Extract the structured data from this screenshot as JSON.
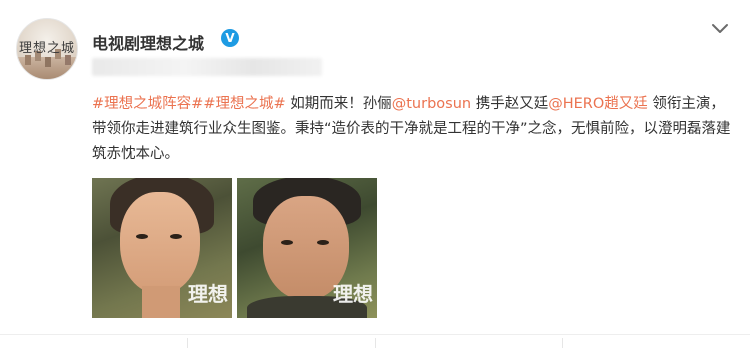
{
  "account": {
    "name": "电视剧理想之城",
    "avatar_text": "理想之城",
    "verified_icon": "verified-badge-icon"
  },
  "post": {
    "hashtag_1": "#理想之城阵容#",
    "hashtag_2": "#理想之城#",
    "text_1": " 如期而来！孙俪",
    "mention_1": "@turbosun",
    "text_2": " 携手赵又廷",
    "mention_2": "@HERO趙又廷",
    "text_3": " 领衔主演，带领你走进建筑行业众生图鉴。秉持“造价表的干净就是工程的干净”之念，无惧前险，以澄明磊落建筑赤忱本心。"
  },
  "images": [
    {
      "watermark": "理想"
    },
    {
      "watermark": "理想"
    }
  ],
  "colors": {
    "link": "#eb7350",
    "verified": "#1e9be3",
    "text": "#333333"
  },
  "menu_icon": "chevron-down-icon"
}
